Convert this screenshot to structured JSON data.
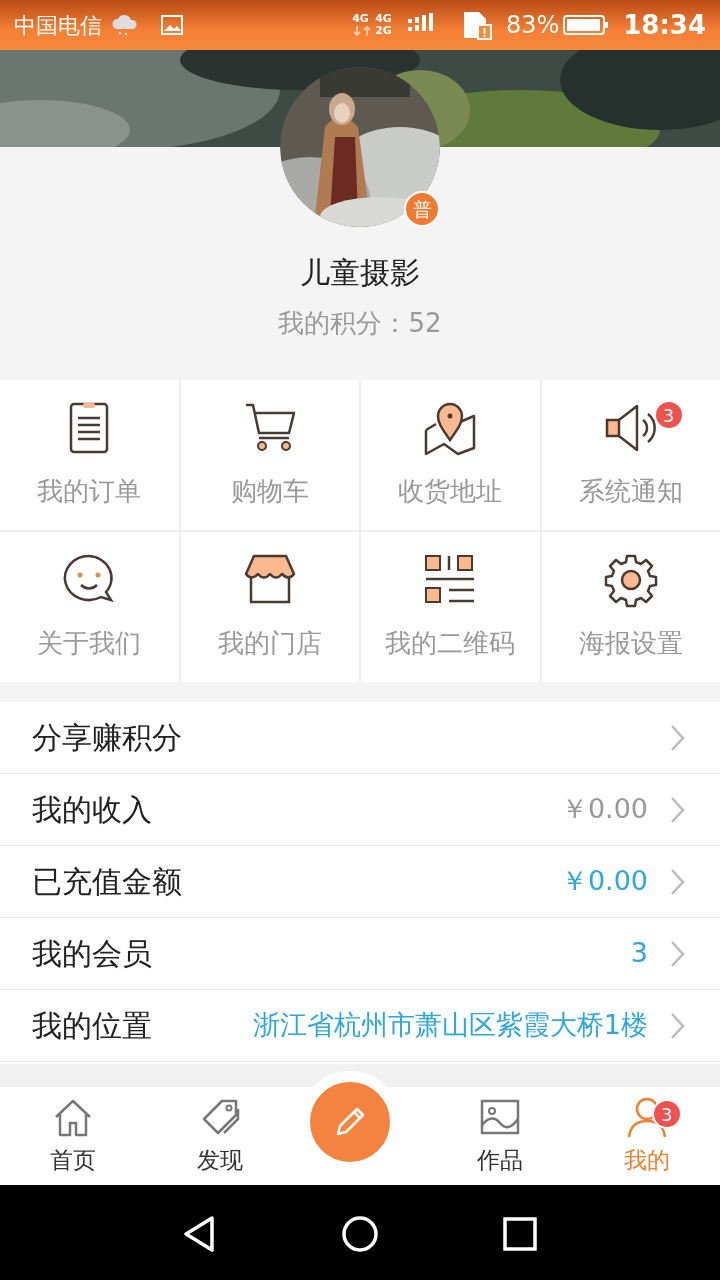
{
  "status_bar": {
    "carrier": "中国电信",
    "network": [
      "4G",
      "4G",
      "2G"
    ],
    "battery": "83%",
    "time": "18:34"
  },
  "profile": {
    "name": "儿童摄影",
    "level_badge": "普",
    "points": "我的积分：52"
  },
  "grid": [
    {
      "label": "我的订单"
    },
    {
      "label": "购物车"
    },
    {
      "label": "收货地址"
    },
    {
      "label": "系统通知",
      "badge": "3"
    },
    {
      "label": "关于我们"
    },
    {
      "label": "我的门店"
    },
    {
      "label": "我的二维码"
    },
    {
      "label": "海报设置"
    }
  ],
  "menu": [
    {
      "label": "分享赚积分"
    },
    {
      "label": "我的收入",
      "value": "￥0.00",
      "highlighted": false
    },
    {
      "label": "已充值金额",
      "value": "￥0.00",
      "highlighted": true
    },
    {
      "label": "我的会员",
      "value": "3",
      "highlighted": true
    },
    {
      "label": "我的位置",
      "value": "浙江省杭州市萧山区紫霞大桥1楼",
      "highlighted": true
    }
  ],
  "tabs": [
    {
      "label": "首页",
      "selected": false
    },
    {
      "label": "发现",
      "selected": false
    },
    {
      "kind": "compose"
    },
    {
      "label": "作品",
      "selected": false
    },
    {
      "label": "我的",
      "selected": true,
      "badge": "3"
    }
  ]
}
